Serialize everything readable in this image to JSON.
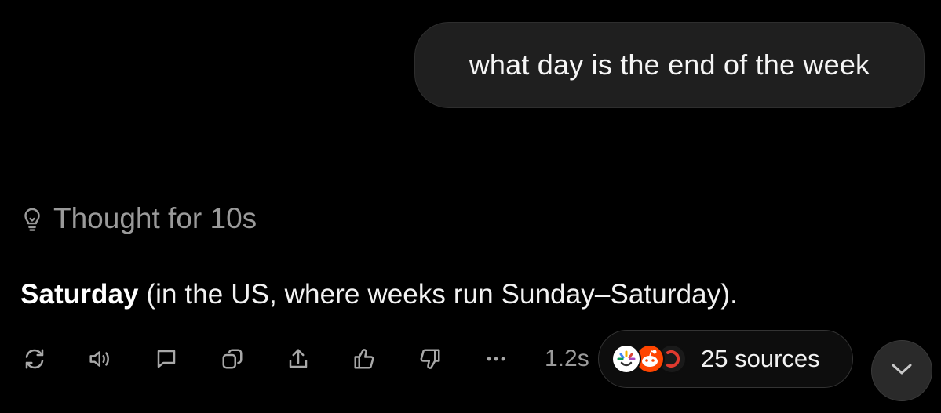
{
  "user_message": "what day is the end of the week",
  "thought": {
    "label": "Thought for 10s",
    "icon": "lightbulb-icon"
  },
  "answer": {
    "bold": "Saturday",
    "rest": " (in the US, where weeks run Sunday–Saturday)."
  },
  "actions": {
    "icons": [
      "regenerate-icon",
      "read-aloud-icon",
      "comment-icon",
      "copy-icon",
      "share-icon",
      "thumbs-up-icon",
      "thumbs-down-icon",
      "more-icon"
    ],
    "timing": "1.2s"
  },
  "sources": {
    "label": "25 sources",
    "favicons": [
      "colorful-sunburst-favicon",
      "reddit-favicon",
      "dark-red-favicon"
    ]
  },
  "scroll_button": {
    "icon": "chevron-down-icon"
  },
  "colors": {
    "background": "#000000",
    "bubble": "#1f1f1f",
    "muted_text": "#9a9a9a",
    "icon": "#a8a8a8",
    "reddit": "#ff4500"
  }
}
